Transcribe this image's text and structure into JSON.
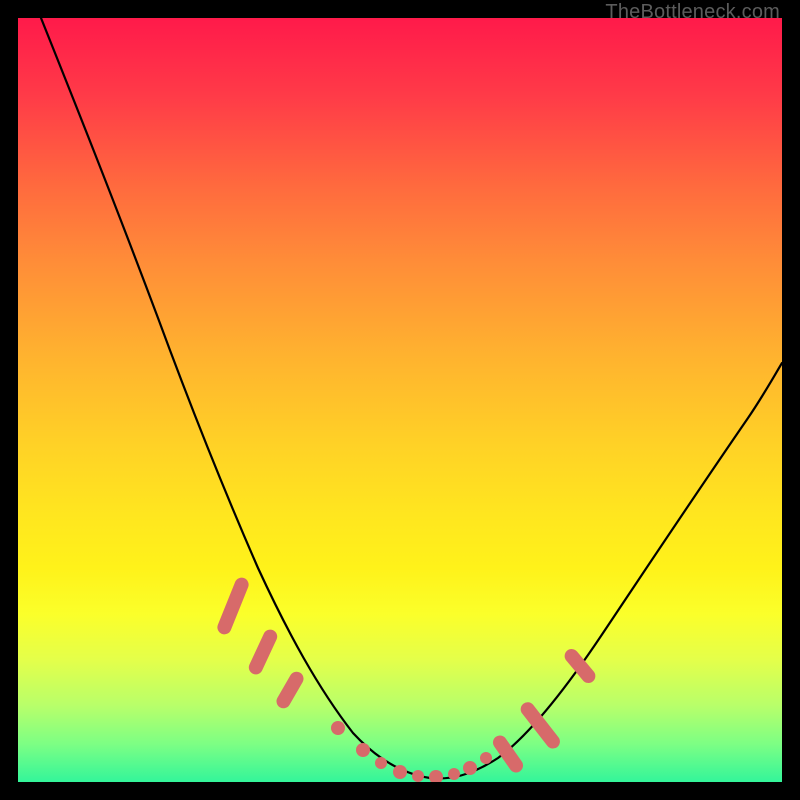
{
  "attribution": "TheBottleneck.com",
  "colors": {
    "background": "#000000",
    "gradient_top": "#ff1a4a",
    "gradient_bottom": "#33f59a",
    "curve": "#000000",
    "marker": "#d76a6a"
  },
  "chart_data": {
    "type": "line",
    "title": "",
    "xlabel": "",
    "ylabel": "",
    "xlim": [
      0,
      100
    ],
    "ylim": [
      0,
      100
    ],
    "series": [
      {
        "name": "bottleneck-curve",
        "x": [
          3,
          8,
          13,
          18,
          23,
          27,
          31,
          35,
          38,
          41,
          44,
          46,
          49,
          51,
          53,
          55,
          58,
          60,
          63,
          67,
          71,
          76,
          81,
          87,
          93,
          100
        ],
        "y": [
          100,
          88,
          76,
          64,
          52,
          42,
          34,
          26,
          20,
          14,
          9,
          6,
          3,
          1.5,
          0.5,
          0.5,
          1,
          2.5,
          5,
          10,
          16,
          24,
          32,
          40,
          48,
          56
        ]
      }
    ],
    "highlight_segments": [
      {
        "name": "left-cluster",
        "x_range": [
          27,
          38
        ],
        "approx_y": [
          42,
          20
        ]
      },
      {
        "name": "valley-floor",
        "x_range": [
          49,
          58
        ],
        "approx_y": [
          3,
          1
        ]
      },
      {
        "name": "right-cluster",
        "x_range": [
          60,
          71
        ],
        "approx_y": [
          2.5,
          16
        ]
      }
    ],
    "markers": [
      {
        "x": 29,
        "y": 38
      },
      {
        "x": 33,
        "y": 29
      },
      {
        "x": 36,
        "y": 23
      },
      {
        "x": 46,
        "y": 6
      },
      {
        "x": 48,
        "y": 3.5
      },
      {
        "x": 50,
        "y": 2
      },
      {
        "x": 52,
        "y": 1
      },
      {
        "x": 54,
        "y": 0.5
      },
      {
        "x": 56,
        "y": 0.7
      },
      {
        "x": 58,
        "y": 1.2
      },
      {
        "x": 61,
        "y": 3
      },
      {
        "x": 63,
        "y": 5
      },
      {
        "x": 66,
        "y": 9
      },
      {
        "x": 69,
        "y": 14
      }
    ]
  }
}
